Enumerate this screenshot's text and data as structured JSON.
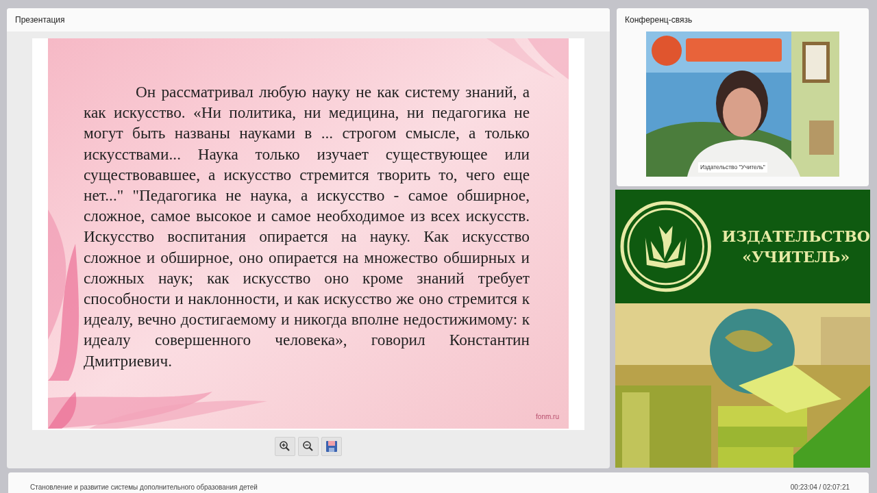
{
  "presentation_panel": {
    "title": "Презентация",
    "slide": {
      "paragraph": "Он рассматривал любую науку не как систему знаний, а как искусство. «Ни политика, ни медицина, ни педагогика не могут быть названы науками в ... строгом смысле, а только искусствами... Наука только изучает существующее или существовавшее, а искусство стремится творить то, чего еще нет...\" \"Педагогика не наука, а искусство - самое обширное, сложное, самое высокое и самое необходимое из всех искусств. Искусство воспитания опирается на науку. Как искусство сложное и обширное, оно опирается на множество обширных и сложных наук; как искусство оно кроме знаний требует способности и наклонности, и как искусство же оно стремится к идеалу, вечно достигаемому и никогда вполне недостижимому: к идеалу совершенного человека», говорил Константин Дмитриевич.",
      "footer": "fonm.ru"
    },
    "toolbar": [
      {
        "kind": "zoom_in"
      },
      {
        "kind": "zoom_out"
      },
      {
        "kind": "save"
      }
    ]
  },
  "conference_panel": {
    "title": "Конференц-связь",
    "video": {
      "kind": "picture",
      "caption": "Издательство \"Учитель\""
    }
  },
  "publisher_banner": {
    "line_1": "ИЗДАТЕЛЬСТВО",
    "line_2": "«УЧИТЕЛЬ»"
  },
  "status_bar": {
    "course_title": "Становление и развитие системы дополнительного образования детей",
    "time": "00:23:04 / 02:07:21"
  }
}
